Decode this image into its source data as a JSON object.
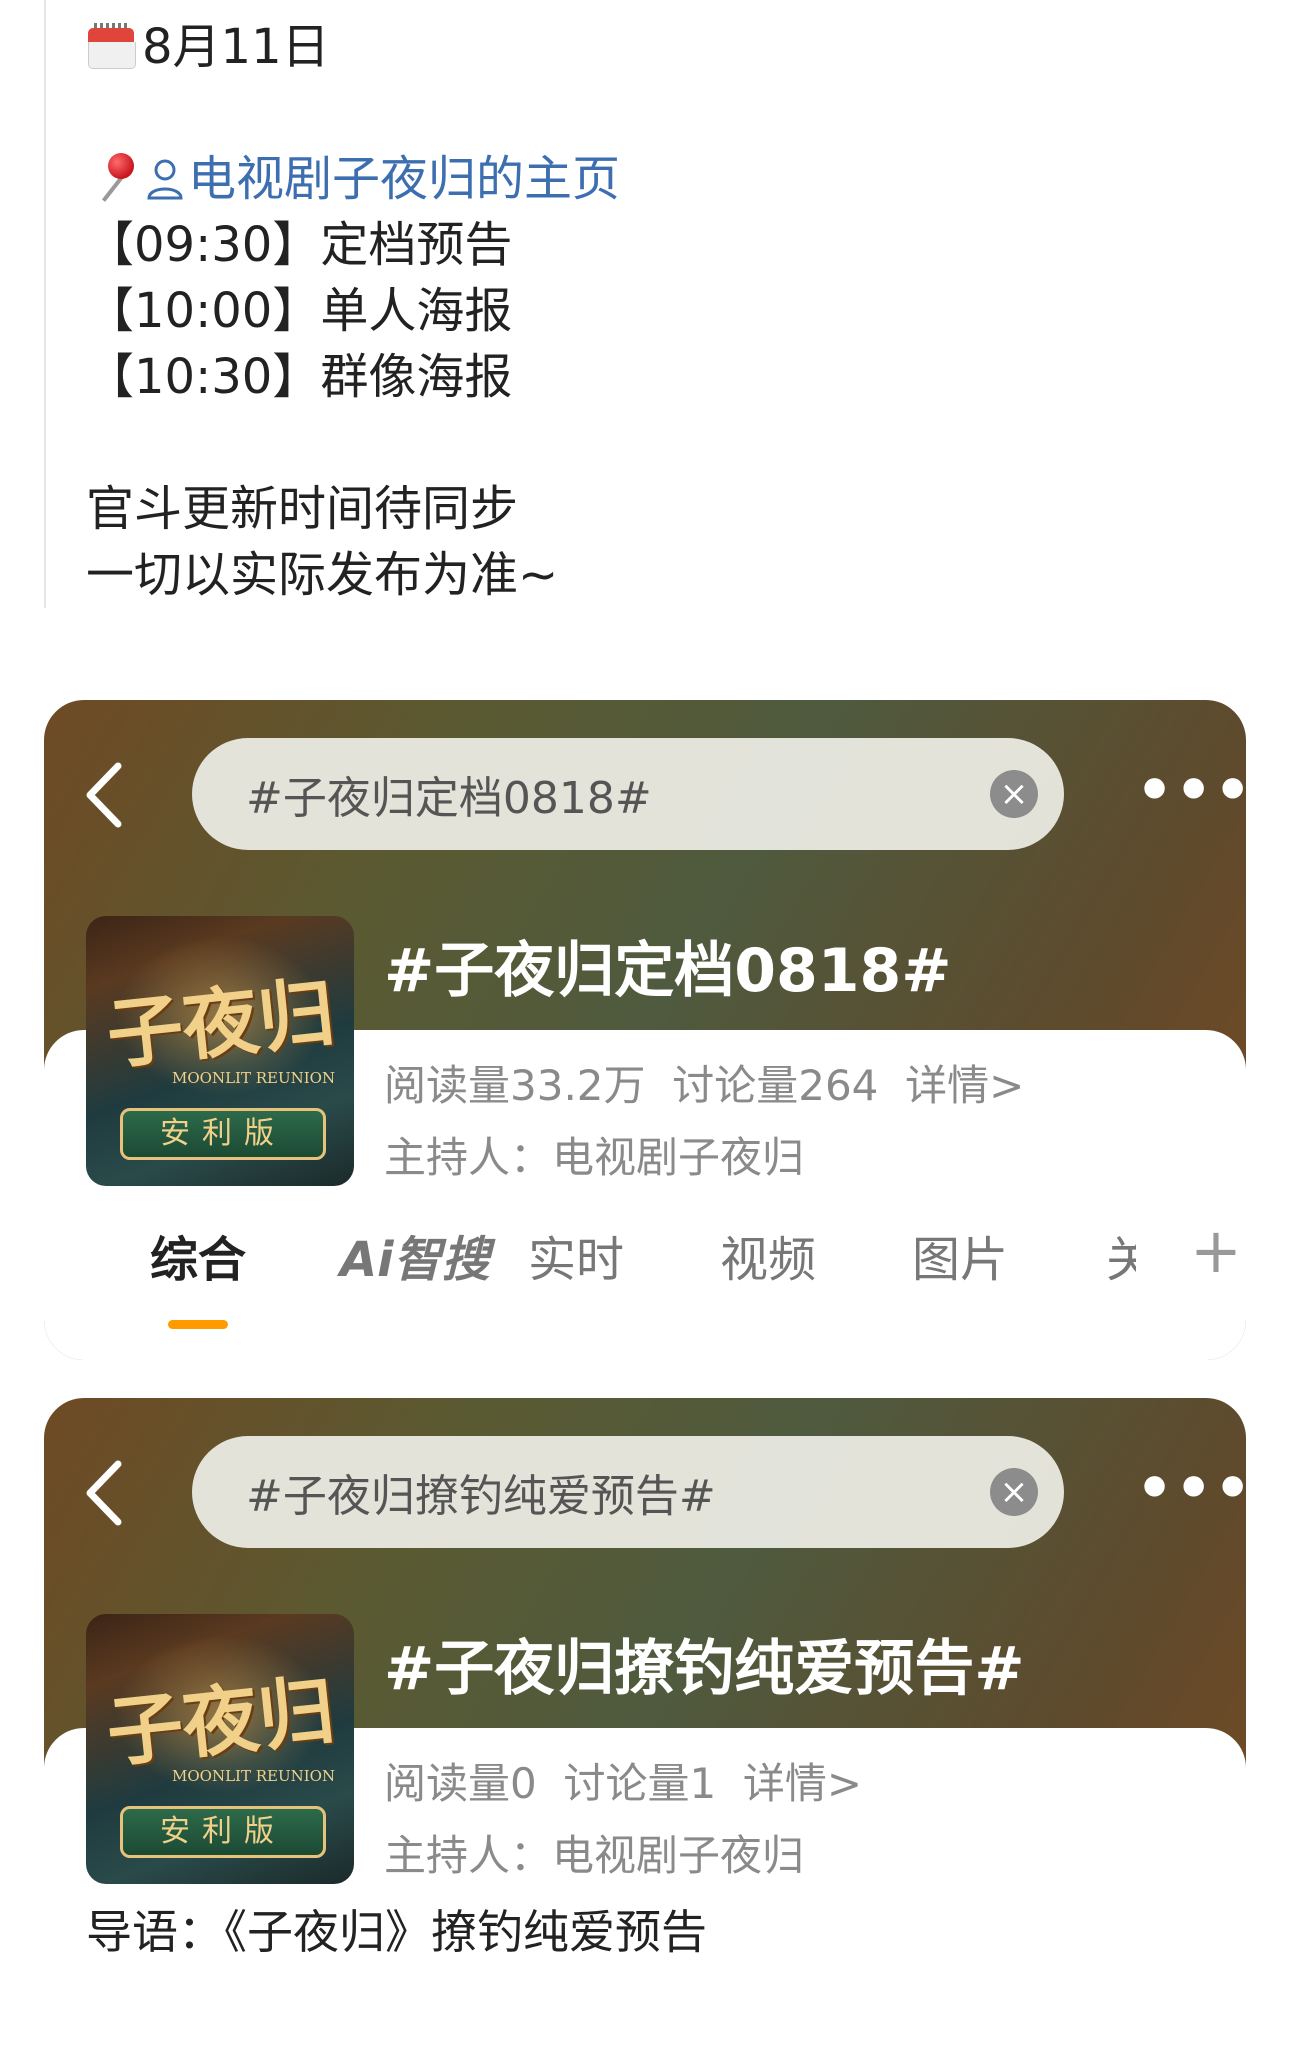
{
  "post": {
    "date_label": "8月11日",
    "account_link": "电视剧子夜归的主页",
    "schedule": [
      {
        "time": "【09:30】",
        "item": "定档预告"
      },
      {
        "time": "【10:00】",
        "item": "单人海报"
      },
      {
        "time": "【10:30】",
        "item": "群像海报"
      }
    ],
    "note_line1": "官斗更新时间待同步",
    "note_line2": "一切以实际发布为准~"
  },
  "card1": {
    "search_query": "#子夜归定档0818#",
    "topic_title": "#子夜归定档0818#",
    "reads": "阅读量33.2万",
    "discussions": "讨论量264",
    "details": "详情>",
    "host_label": "主持人：",
    "host": "电视剧子夜归",
    "poster_title": "子夜归",
    "poster_en": "MOONLIT REUNION",
    "poster_badge": "安利版",
    "tabs": [
      "综合",
      "Ai智搜",
      "实时",
      "视频",
      "图片",
      "关"
    ],
    "active_tab": "综合"
  },
  "card2": {
    "search_query": "#子夜归撩钓纯爱预告#",
    "topic_title": "#子夜归撩钓纯爱预告#",
    "reads": "阅读量0",
    "discussions": "讨论量1",
    "details": "详情>",
    "host_label": "主持人：",
    "host": "电视剧子夜归",
    "poster_title": "子夜归",
    "poster_en": "MOONLIT REUNION",
    "poster_badge": "安利版",
    "intro": "导语：《子夜归》撩钓纯爱预告"
  },
  "icons": {
    "calendar": "calendar-icon",
    "pin": "pushpin-icon",
    "user": "user-icon",
    "back": "back-chevron-icon",
    "clear": "clear-icon",
    "more": "more-icon",
    "plus": "plus-icon"
  },
  "colors": {
    "link": "#3d6fb0",
    "tab_underline": "#ff9a00",
    "meta_text": "#8a8a8a"
  }
}
